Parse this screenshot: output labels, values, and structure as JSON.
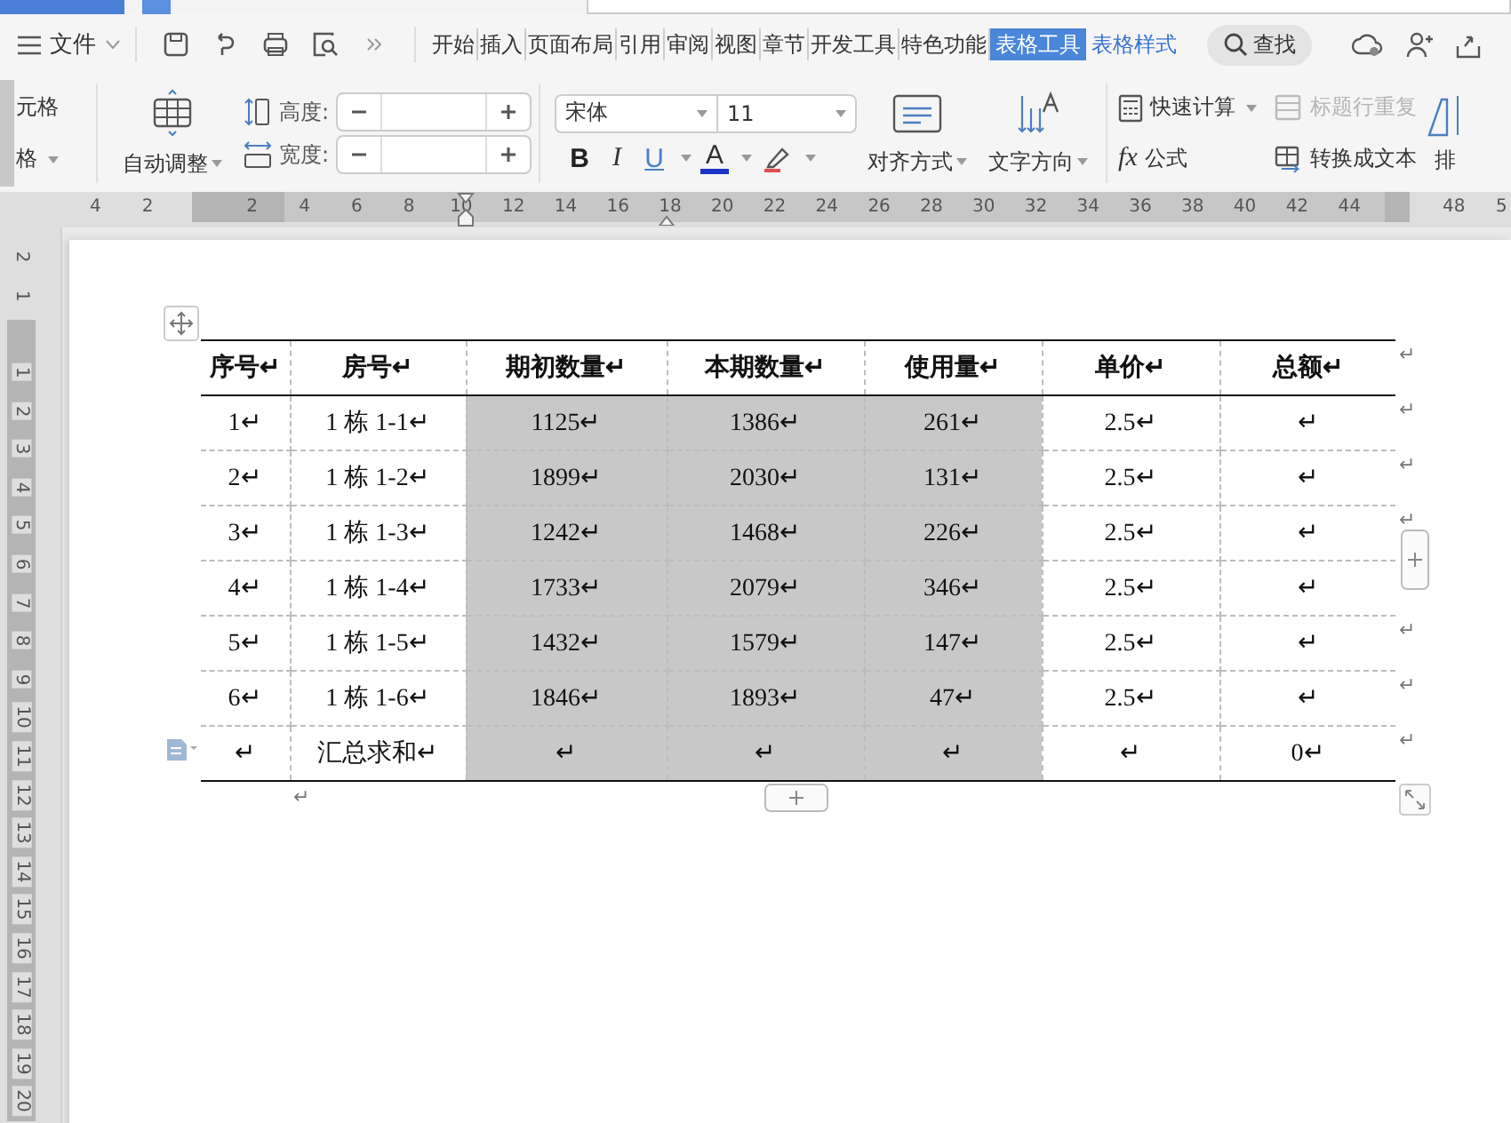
{
  "menu": {
    "file_label": "文件",
    "tabs": [
      {
        "label": "开始",
        "kind": "normal",
        "selected": false
      },
      {
        "label": "插入",
        "kind": "normal",
        "selected": false
      },
      {
        "label": "页面布局",
        "kind": "normal",
        "selected": false
      },
      {
        "label": "引用",
        "kind": "normal",
        "selected": false
      },
      {
        "label": "审阅",
        "kind": "normal",
        "selected": false
      },
      {
        "label": "视图",
        "kind": "normal",
        "selected": false
      },
      {
        "label": "章节",
        "kind": "normal",
        "selected": false
      },
      {
        "label": "开发工具",
        "kind": "normal",
        "selected": false
      },
      {
        "label": "特色功能",
        "kind": "normal",
        "selected": false
      },
      {
        "label": "表格工具",
        "kind": "context",
        "selected": true
      },
      {
        "label": "表格样式",
        "kind": "context",
        "selected": false
      }
    ],
    "search_label": "查找"
  },
  "ribbon": {
    "cell_group": [
      "元格",
      "格"
    ],
    "autofit": "自动调整",
    "height_label": "高度:",
    "width_label": "宽度:",
    "font": "宋体",
    "font_size": "11",
    "format_letters": [
      "B",
      "I",
      "U",
      "A"
    ],
    "align": "对齐方式",
    "text_direction": "文字方向",
    "quick_calc": "快速计算",
    "formula_symbol": "fx",
    "formula": "公式",
    "repeat_header": {
      "label": "标题行重复",
      "disabled": true
    },
    "to_text": "转换成文本",
    "sort": "排"
  },
  "ruler": {
    "left_numbers": [
      "4",
      "2"
    ],
    "numbers": [
      "2",
      "4",
      "6",
      "8",
      "10",
      "12",
      "14",
      "16",
      "18",
      "20",
      "22",
      "24",
      "26",
      "28",
      "30",
      "32",
      "34",
      "36",
      "38",
      "40",
      "42",
      "44"
    ],
    "right_numbers": [
      "48",
      "5"
    ]
  },
  "vertical_ruler": {
    "top_numbers": [
      "2",
      "1"
    ],
    "numbers": [
      "1",
      "2",
      "3",
      "4",
      "5",
      "6",
      "7",
      "8",
      "9",
      "10",
      "11",
      "12",
      "13",
      "14",
      "15",
      "16",
      "17",
      "18",
      "19",
      "20"
    ]
  },
  "table": {
    "columns": [
      {
        "label": "序号↵",
        "selected": false
      },
      {
        "label": "房号↵",
        "selected": false
      },
      {
        "label": "期初数量↵",
        "selected": true
      },
      {
        "label": "本期数量↵",
        "selected": true
      },
      {
        "label": "使用量↵",
        "selected": true
      },
      {
        "label": "单价↵",
        "selected": false
      },
      {
        "label": "总额↵",
        "selected": false
      }
    ],
    "header_end_mark": "↵",
    "rows": [
      {
        "cells": [
          "1↵",
          "1 栋 1-1↵",
          "1125↵",
          "1386↵",
          "261↵",
          "2.5↵",
          "↵"
        ],
        "end_mark": "↵"
      },
      {
        "cells": [
          "2↵",
          "1 栋 1-2↵",
          "1899↵",
          "2030↵",
          "131↵",
          "2.5↵",
          "↵"
        ],
        "end_mark": "↵"
      },
      {
        "cells": [
          "3↵",
          "1 栋 1-3↵",
          "1242↵",
          "1468↵",
          "226↵",
          "2.5↵",
          "↵"
        ],
        "end_mark": "↵"
      },
      {
        "cells": [
          "4↵",
          "1 栋 1-4↵",
          "1733↵",
          "2079↵",
          "346↵",
          "2.5↵",
          "↵"
        ]
      },
      {
        "cells": [
          "5↵",
          "1 栋 1-5↵",
          "1432↵",
          "1579↵",
          "147↵",
          "2.5↵",
          "↵"
        ],
        "end_mark": "↵"
      },
      {
        "cells": [
          "6↵",
          "1 栋 1-6↵",
          "1846↵",
          "1893↵",
          "47↵",
          "2.5↵",
          "↵"
        ],
        "end_mark": "↵"
      },
      {
        "cells": [
          "↵",
          "汇总求和↵",
          "↵",
          "↵",
          "↵",
          "↵",
          "0↵"
        ],
        "end_mark": "↵"
      }
    ]
  },
  "after_table_mark": "↵"
}
